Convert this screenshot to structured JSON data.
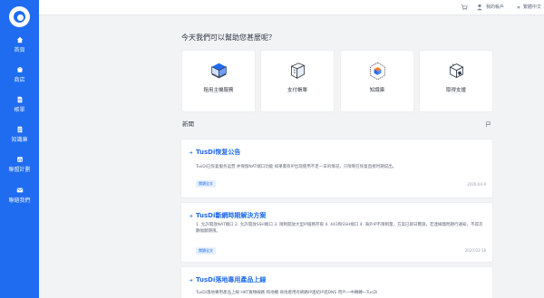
{
  "brand": {
    "name": "TusDi"
  },
  "sidebar": {
    "items": [
      {
        "label": "首頁",
        "icon": "home-icon"
      },
      {
        "label": "商店",
        "icon": "shop-icon"
      },
      {
        "label": "帳單",
        "icon": "bill-icon"
      },
      {
        "label": "知識庫",
        "icon": "knowledge-icon"
      },
      {
        "label": "聯盟計劃",
        "icon": "affiliate-icon"
      },
      {
        "label": "聯絡我們",
        "icon": "contact-icon"
      }
    ]
  },
  "header": {
    "account": "我的帳戶",
    "language": "繁體中文"
  },
  "welcome": "今天我們可以幫助您甚麼呢？",
  "quick_actions": [
    {
      "label": "租用主機服務",
      "icon": "server-box-icon"
    },
    {
      "label": "支付帳單",
      "icon": "payment-box-icon"
    },
    {
      "label": "知識庫",
      "icon": "knowledge-cube-icon"
    },
    {
      "label": "取得支援",
      "icon": "support-box-icon"
    }
  ],
  "news": {
    "title": "新聞",
    "items": [
      {
        "headline": "TusDi恢复公告",
        "excerpt": "TusDi已恢复服务运营 并保留NAT端口功能 如果需有IP出现使用不足一日的情况，只限制在恢复直接时期说出。",
        "read_more": "閱讀全文",
        "date": "2020-04-9"
      },
      {
        "headline": "TusDi斷網時期解決方案",
        "excerpt": "1. 允許開放NAT端口 2. 允許開放SSH端口 3. 限制開放大型IP服務存取 4. 443和SSH端口 4. 海外IP不限制量，方案已即日實施，若連線無問題行通知，不得次數幅額期限。",
        "read_more": "閱讀全文",
        "date": "2020-03-18"
      },
      {
        "headline": "TusDi落地專用產品上線",
        "excerpt": "TusDi落地專用產品上線 HKT寬頻線路 和地機 商地產用有網路IP連結IP進DNS 用戶一中轉轉一TusDi",
        "read_more": "閱讀全文",
        "date": ""
      }
    ]
  },
  "colors": {
    "primary": "#1f6cf0",
    "sidebar_bg": "#1f6cf0",
    "page_bg": "#f2f3f5",
    "card_bg": "#ffffff",
    "text_dark": "#2f3542",
    "text_muted": "#5f6777"
  }
}
